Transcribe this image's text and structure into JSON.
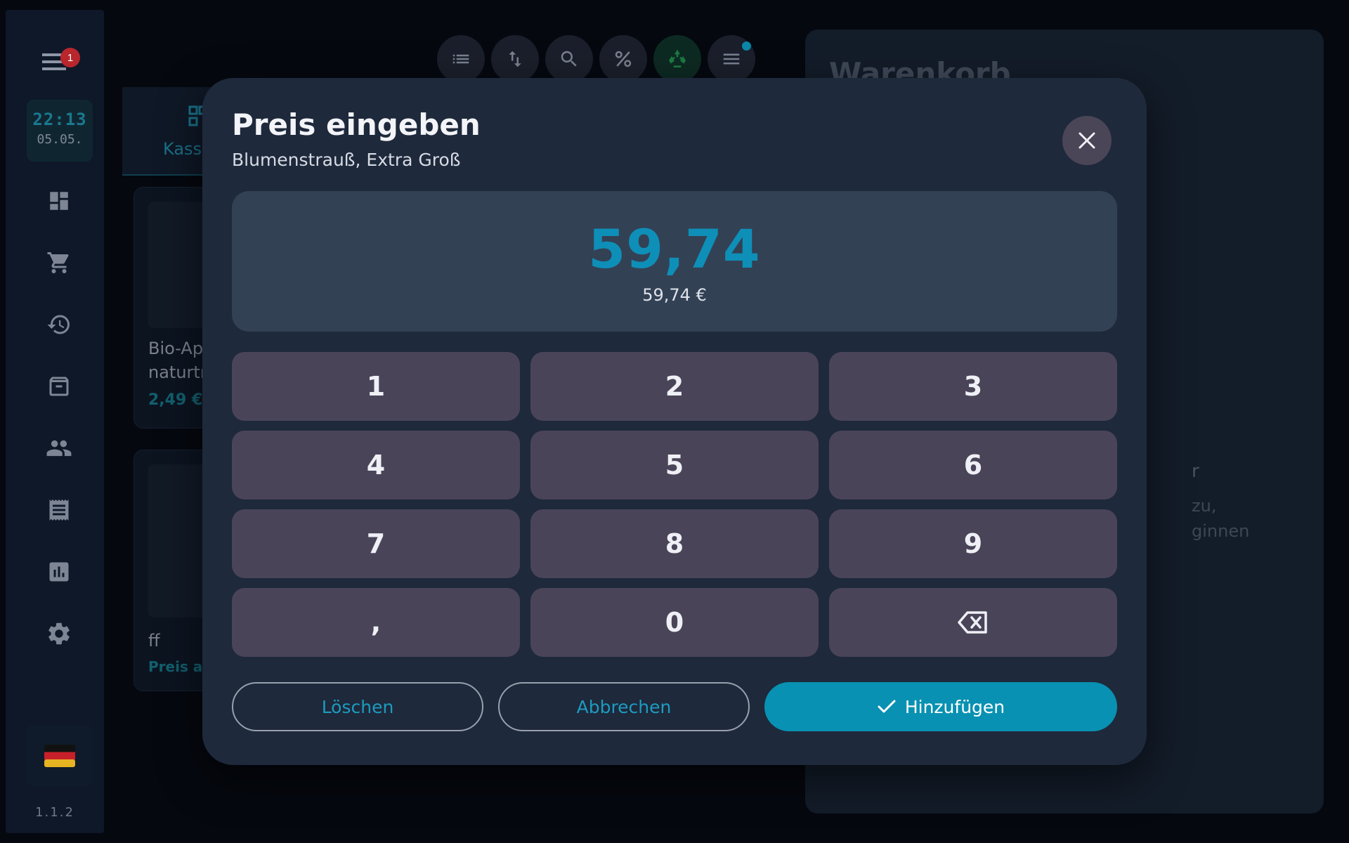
{
  "sidebar": {
    "menu_badge": "1",
    "clock_time": "22:13",
    "clock_date": "05.05.",
    "version": "1.1.2",
    "items": [
      {
        "name": "dashboard-icon"
      },
      {
        "name": "cart-icon"
      },
      {
        "name": "history-icon"
      },
      {
        "name": "archive-icon"
      },
      {
        "name": "customers-icon"
      },
      {
        "name": "receipt-icon"
      },
      {
        "name": "reports-icon"
      },
      {
        "name": "settings-icon"
      }
    ],
    "language_flag": "de-flag-icon"
  },
  "toolbar": {
    "buttons": [
      "list-icon",
      "sort-icon",
      "search-icon",
      "percent-icon",
      "recycle-icon",
      "menu-icon"
    ]
  },
  "tabs": {
    "active_label": "Kass"
  },
  "products": [
    {
      "name_line1": "Bio-Ap",
      "name_line2": "naturtr",
      "price": "2,49 €"
    },
    {
      "name_line1": "ff",
      "price": "Preis an"
    }
  ],
  "cart": {
    "title": "Warenkorb",
    "empty_title_fragment": "r",
    "empty_text_line1": "zu,",
    "empty_text_line2": "ginnen"
  },
  "modal": {
    "title": "Preis eingeben",
    "subtitle": "Blumenstrauß, Extra Groß",
    "display_value": "59,74",
    "display_formatted": "59,74 €",
    "keys": [
      "1",
      "2",
      "3",
      "4",
      "5",
      "6",
      "7",
      "8",
      "9",
      ",",
      "0",
      "⌫"
    ],
    "clear_label": "Löschen",
    "cancel_label": "Abbrechen",
    "add_label": "Hinzufügen"
  },
  "colors": {
    "accent": "#0891b2",
    "modal_bg": "#1e293b",
    "display_bg": "#334155",
    "key_bg": "#4a4459",
    "badge": "#b9262c"
  }
}
